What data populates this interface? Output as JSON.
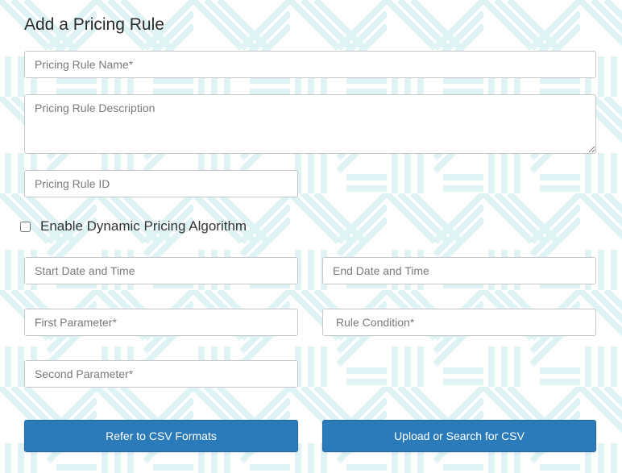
{
  "form": {
    "title": "Add a Pricing Rule",
    "fields": {
      "rule_name": {
        "placeholder": "Pricing Rule Name*",
        "value": ""
      },
      "rule_description": {
        "placeholder": "Pricing Rule Description",
        "value": ""
      },
      "rule_id": {
        "placeholder": "Pricing Rule ID",
        "value": ""
      },
      "start_datetime": {
        "placeholder": "Start Date and Time",
        "value": ""
      },
      "end_datetime": {
        "placeholder": "End Date and Time",
        "value": ""
      },
      "first_parameter": {
        "placeholder": "First Parameter*",
        "value": ""
      },
      "rule_condition": {
        "placeholder": "Rule Condition*",
        "value": ""
      },
      "second_parameter": {
        "placeholder": "Second Parameter*",
        "value": ""
      }
    },
    "dynamic_pricing": {
      "label": "Enable Dynamic Pricing Algorithm",
      "checked": false
    },
    "buttons": {
      "csv_formats": "Refer to CSV Formats",
      "upload_csv": "Upload or Search for CSV"
    }
  },
  "colors": {
    "button_bg": "#2b7bba",
    "pattern": "#dff3f5"
  }
}
